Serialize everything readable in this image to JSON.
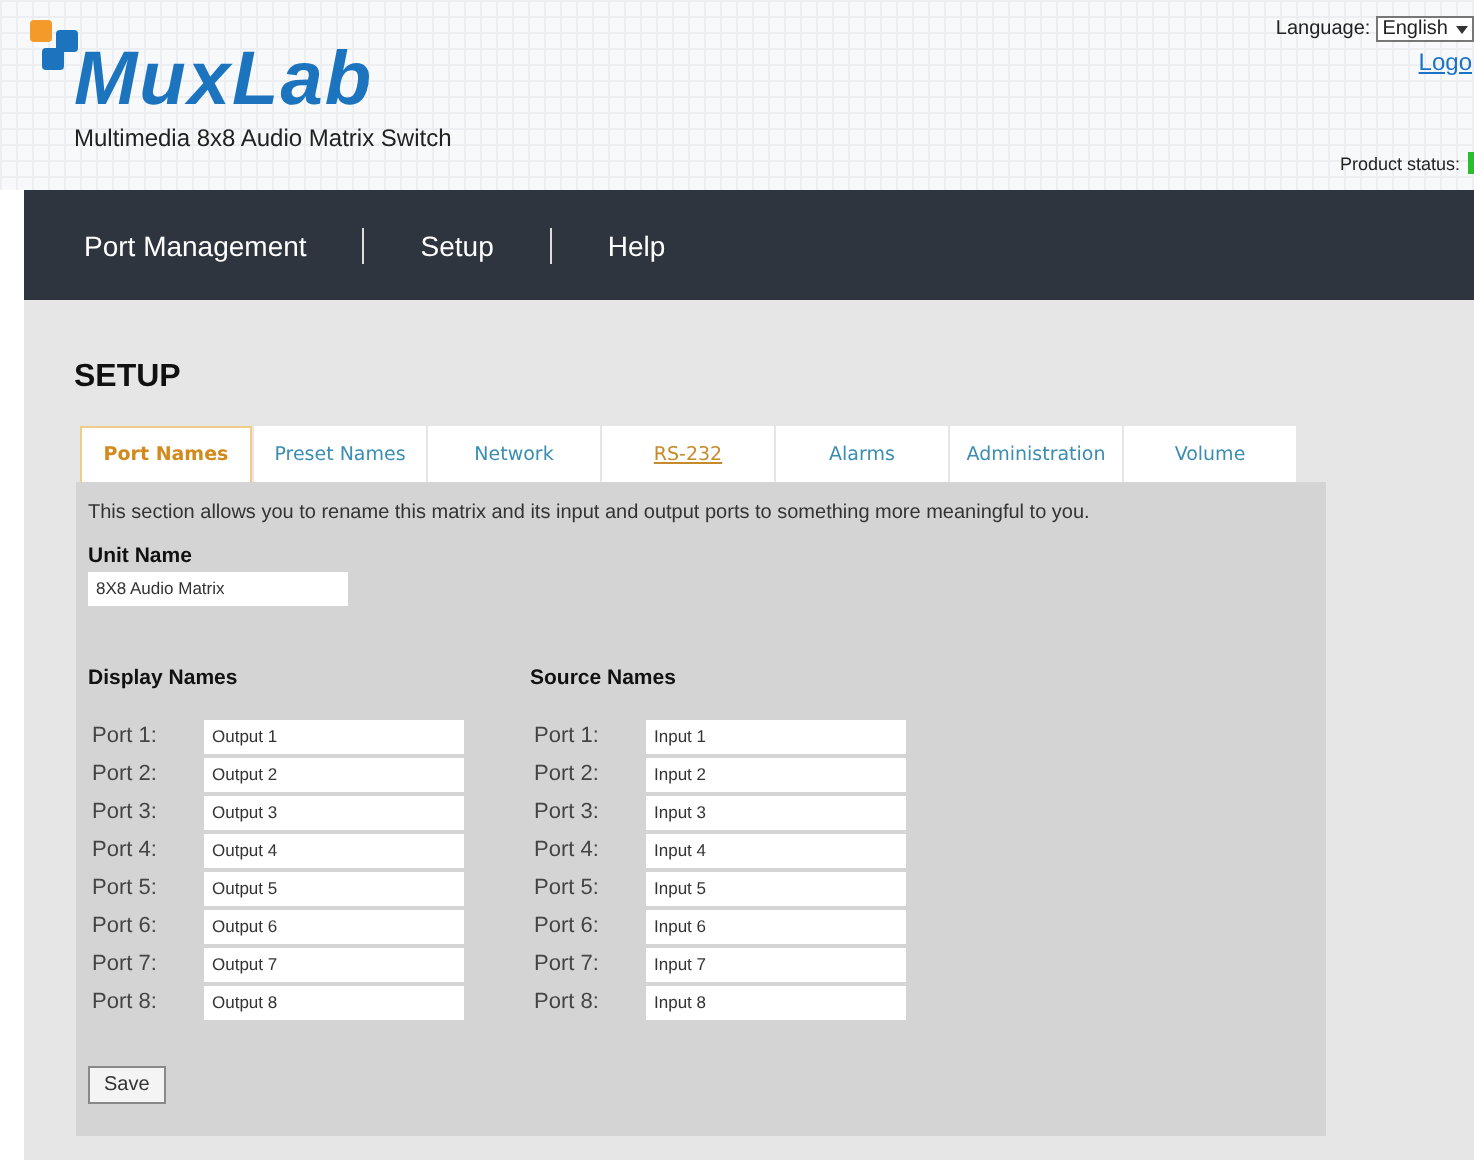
{
  "header": {
    "brand": "MuxLab",
    "subtitle": "Multimedia 8x8 Audio Matrix Switch",
    "language_label": "Language:",
    "language_value": "English",
    "logout_link": "Logo",
    "product_status_label": "Product status:"
  },
  "nav": [
    {
      "label": "Port Management"
    },
    {
      "label": "Setup"
    },
    {
      "label": "Help"
    }
  ],
  "page_title": "SETUP",
  "tabs": [
    {
      "label": "Port Names",
      "selected": true,
      "hovered": false
    },
    {
      "label": "Preset Names",
      "selected": false,
      "hovered": false
    },
    {
      "label": "Network",
      "selected": false,
      "hovered": false
    },
    {
      "label": "RS-232",
      "selected": false,
      "hovered": true
    },
    {
      "label": "Alarms",
      "selected": false,
      "hovered": false
    },
    {
      "label": "Administration",
      "selected": false,
      "hovered": false
    },
    {
      "label": "Volume",
      "selected": false,
      "hovered": false
    }
  ],
  "description": "This section allows you to rename this matrix and its input and output ports to something more meaningful to you.",
  "unit_name": {
    "label": "Unit Name",
    "value": "8X8 Audio Matrix"
  },
  "columns": [
    {
      "title": "Display Names",
      "ports": [
        {
          "label": "Port 1:",
          "value": "Output 1"
        },
        {
          "label": "Port 2:",
          "value": "Output 2"
        },
        {
          "label": "Port 3:",
          "value": "Output 3"
        },
        {
          "label": "Port 4:",
          "value": "Output 4"
        },
        {
          "label": "Port 5:",
          "value": "Output 5"
        },
        {
          "label": "Port 6:",
          "value": "Output 6"
        },
        {
          "label": "Port 7:",
          "value": "Output 7"
        },
        {
          "label": "Port 8:",
          "value": "Output 8"
        }
      ]
    },
    {
      "title": "Source Names",
      "ports": [
        {
          "label": "Port 1:",
          "value": "Input 1"
        },
        {
          "label": "Port 2:",
          "value": "Input 2"
        },
        {
          "label": "Port 3:",
          "value": "Input 3"
        },
        {
          "label": "Port 4:",
          "value": "Input 4"
        },
        {
          "label": "Port 5:",
          "value": "Input 5"
        },
        {
          "label": "Port 6:",
          "value": "Input 6"
        },
        {
          "label": "Port 7:",
          "value": "Input 7"
        },
        {
          "label": "Port 8:",
          "value": "Input 8"
        }
      ]
    }
  ],
  "save_button": "Save"
}
